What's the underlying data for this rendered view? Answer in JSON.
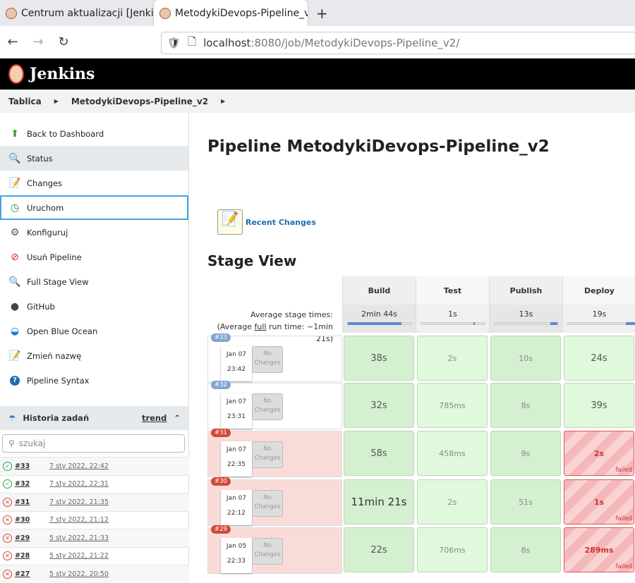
{
  "browser": {
    "tabs": [
      {
        "title": "Centrum aktualizacji [Jenkins]"
      },
      {
        "title": "MetodykiDevops-Pipeline_v2 [Jenkins]"
      }
    ],
    "url_host": "localhost",
    "url_rest": ":8080/job/MetodykiDevops-Pipeline_v2/"
  },
  "header": {
    "title": "Jenkins"
  },
  "breadcrumb": [
    "Tablica",
    "MetodykiDevops-Pipeline_v2"
  ],
  "sidebar": {
    "items": [
      {
        "label": "Back to Dashboard",
        "icon": "arrow-up-icon"
      },
      {
        "label": "Status",
        "icon": "magnifier-icon"
      },
      {
        "label": "Changes",
        "icon": "notepad-icon"
      },
      {
        "label": "Uruchom",
        "icon": "clock-run-icon"
      },
      {
        "label": "Konfiguruj",
        "icon": "gear-icon"
      },
      {
        "label": "Usuń Pipeline",
        "icon": "no-entry-icon"
      },
      {
        "label": "Full Stage View",
        "icon": "magnifier-icon"
      },
      {
        "label": "GitHub",
        "icon": "github-icon"
      },
      {
        "label": "Open Blue Ocean",
        "icon": "blue-ocean-icon"
      },
      {
        "label": "Zmień nazwę",
        "icon": "notepad-icon"
      },
      {
        "label": "Pipeline Syntax",
        "icon": "help-icon"
      }
    ]
  },
  "history": {
    "title": "Historia zadań",
    "trend": "trend",
    "search_placeholder": "szukaj",
    "builds": [
      {
        "num": "#33",
        "date": "7 sty 2022, 22:42",
        "status": "success"
      },
      {
        "num": "#32",
        "date": "7 sty 2022, 22:31",
        "status": "success"
      },
      {
        "num": "#31",
        "date": "7 sty 2022, 21:35",
        "status": "failed"
      },
      {
        "num": "#30",
        "date": "7 sty 2022, 21:12",
        "status": "failed"
      },
      {
        "num": "#29",
        "date": "5 sty 2022, 21:33",
        "status": "failed"
      },
      {
        "num": "#28",
        "date": "5 sty 2022, 21:22",
        "status": "failed"
      },
      {
        "num": "#27",
        "date": "5 sty 2022, 20:50",
        "status": "failed"
      }
    ]
  },
  "main": {
    "title": "Pipeline MetodykiDevops-Pipeline_v2",
    "recent_changes": "Recent Changes",
    "stage_view": "Stage View",
    "avg_label": "Average stage times:",
    "avg_full_pre": "(Average ",
    "avg_full_link": "full",
    "avg_full_post": " run time: ~1min 21s)",
    "no_changes": "No Changes",
    "failed_label": "failed",
    "stages": [
      {
        "name": "Build",
        "avg": "2min 44s",
        "bar": 0.85
      },
      {
        "name": "Test",
        "avg": "1s",
        "bar": 0.83
      },
      {
        "name": "Publish",
        "avg": "13s",
        "bar": 0.88
      },
      {
        "name": "Deploy",
        "avg": "19s",
        "bar": 0.92
      }
    ],
    "runs": [
      {
        "num": "#33",
        "date": "Jan 07",
        "time": "23:42",
        "failed": false,
        "times": [
          "38s",
          "2s",
          "10s",
          "24s"
        ]
      },
      {
        "num": "#32",
        "date": "Jan 07",
        "time": "23:31",
        "failed": false,
        "times": [
          "32s",
          "785ms",
          "8s",
          "39s"
        ]
      },
      {
        "num": "#31",
        "date": "Jan 07",
        "time": "22:35",
        "failed": true,
        "times": [
          "58s",
          "458ms",
          "9s",
          "2s"
        ]
      },
      {
        "num": "#30",
        "date": "Jan 07",
        "time": "22:12",
        "failed": true,
        "times": [
          "11min 21s",
          "2s",
          "51s",
          "1s"
        ]
      },
      {
        "num": "#29",
        "date": "Jan 05",
        "time": "22:33",
        "failed": true,
        "times": [
          "22s",
          "706ms",
          "8s",
          "289ms"
        ]
      }
    ]
  },
  "colors": {
    "success": "#1ea64b",
    "failed": "#d24939",
    "link": "#1e6cae"
  }
}
